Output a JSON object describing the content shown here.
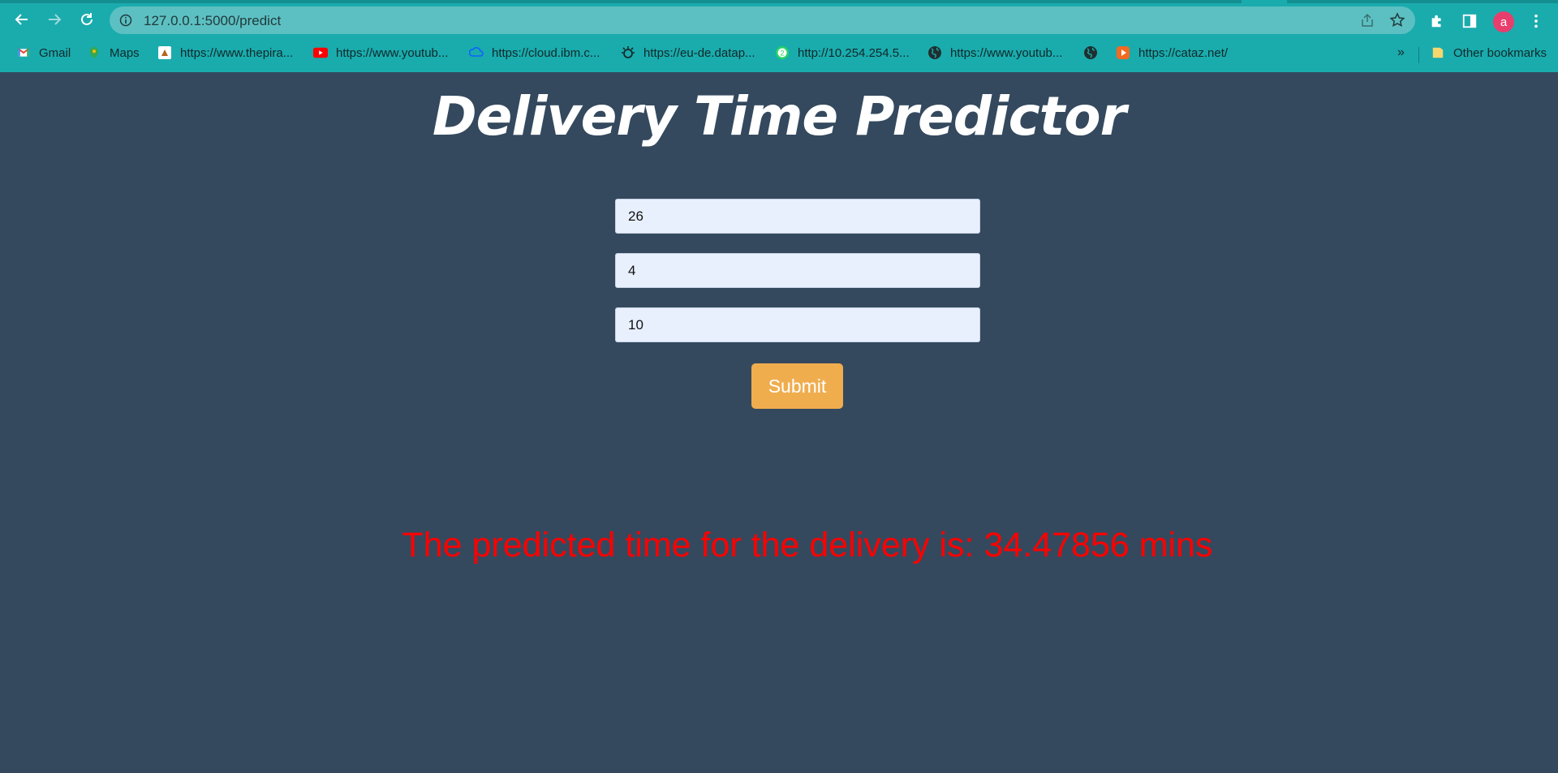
{
  "browser": {
    "url": "127.0.0.1:5000/predict",
    "avatar_letter": "a",
    "bookmarks": [
      {
        "label": "Gmail",
        "icon": "gmail-icon"
      },
      {
        "label": "Maps",
        "icon": "maps-icon"
      },
      {
        "label": "https://www.thepira...",
        "icon": "site-icon"
      },
      {
        "label": "https://www.youtub...",
        "icon": "youtube-icon"
      },
      {
        "label": "https://cloud.ibm.c...",
        "icon": "ibm-cloud-icon"
      },
      {
        "label": "https://eu-de.datap...",
        "icon": "watson-icon"
      },
      {
        "label": "http://10.254.254.5...",
        "icon": "whatsapp-icon"
      },
      {
        "label": "https://www.youtub...",
        "icon": "globe-icon"
      },
      {
        "label": "",
        "icon": "globe-icon"
      },
      {
        "label": "https://cataz.net/",
        "icon": "play-icon"
      }
    ],
    "overflow_label": "»",
    "other_bookmarks_label": "Other bookmarks"
  },
  "page": {
    "title": "Delivery Time Predictor",
    "fields": [
      {
        "value": "26"
      },
      {
        "value": "4"
      },
      {
        "value": "10"
      }
    ],
    "submit_label": "Submit",
    "result_text": "The predicted time for the delivery is: 34.47856 mins"
  },
  "colors": {
    "chrome": "#1aabad",
    "page_background": "#34495e",
    "submit_button": "#f0ad4e",
    "result_text": "#ff0000"
  }
}
